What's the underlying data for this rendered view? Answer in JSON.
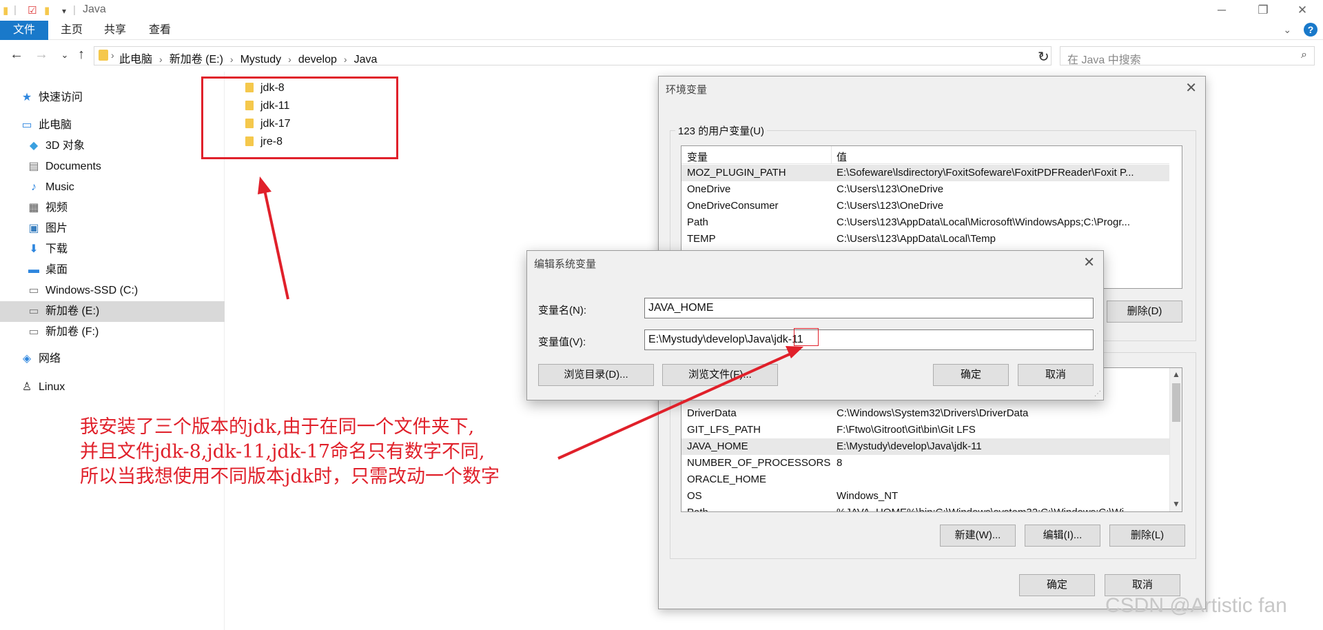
{
  "window": {
    "title": "Java",
    "minimize": "─",
    "maximize": "❐",
    "close": "✕"
  },
  "ribbon": {
    "tabs": [
      "文件",
      "主页",
      "共享",
      "查看"
    ],
    "help": "?"
  },
  "address": {
    "crumbs": [
      "此电脑",
      "新加卷 (E:)",
      "Mystudy",
      "develop",
      "Java"
    ],
    "search_placeholder": "在 Java 中搜索"
  },
  "sidebar": {
    "items": [
      {
        "label": "快速访问",
        "icon": "star-icon"
      },
      {
        "label": "此电脑",
        "icon": "computer-icon"
      },
      {
        "label": "3D 对象",
        "icon": "cube-icon"
      },
      {
        "label": "Documents",
        "icon": "document-icon"
      },
      {
        "label": "Music",
        "icon": "music-icon"
      },
      {
        "label": "视频",
        "icon": "video-icon"
      },
      {
        "label": "图片",
        "icon": "picture-icon"
      },
      {
        "label": "下载",
        "icon": "download-icon"
      },
      {
        "label": "桌面",
        "icon": "desktop-icon"
      },
      {
        "label": "Windows-SSD (C:)",
        "icon": "drive-icon"
      },
      {
        "label": "新加卷 (E:)",
        "icon": "drive-icon",
        "selected": true
      },
      {
        "label": "新加卷 (F:)",
        "icon": "drive-icon"
      },
      {
        "label": "网络",
        "icon": "network-icon"
      },
      {
        "label": "Linux",
        "icon": "linux-icon"
      }
    ]
  },
  "files": [
    "jdk-8",
    "jdk-11",
    "jdk-17",
    "jre-8"
  ],
  "annotation": {
    "lines": [
      "我安装了三个版本的jdk,由于在同一个文件夹下,",
      "并且文件jdk-8,jdk-11,jdk-17命名只有数字不同,",
      "所以当我想使用不同版本jdk时，只需改动一个数字"
    ],
    "color": "#e0202a"
  },
  "env_dialog": {
    "title": "环境变量",
    "user_group_label": "123 的用户变量(U)",
    "col_name": "变量",
    "col_value": "值",
    "user_vars": [
      {
        "name": "MOZ_PLUGIN_PATH",
        "value": "E:\\Sofeware\\lsdirectory\\FoxitSofeware\\FoxitPDFReader\\Foxit P..."
      },
      {
        "name": "OneDrive",
        "value": "C:\\Users\\123\\OneDrive"
      },
      {
        "name": "OneDriveConsumer",
        "value": "C:\\Users\\123\\OneDrive"
      },
      {
        "name": "Path",
        "value": "C:\\Users\\123\\AppData\\Local\\Microsoft\\WindowsApps;C:\\Progr..."
      },
      {
        "name": "TEMP",
        "value": "C:\\Users\\123\\AppData\\Local\\Temp"
      }
    ],
    "user_delete": "删除(D)",
    "sys_vars": [
      {
        "name": "DriverData",
        "value": "C:\\Windows\\System32\\Drivers\\DriverData"
      },
      {
        "name": "GIT_LFS_PATH",
        "value": "F:\\Ftwo\\Gitroot\\Git\\bin\\Git LFS"
      },
      {
        "name": "JAVA_HOME",
        "value": "E:\\Mystudy\\develop\\Java\\jdk-11"
      },
      {
        "name": "NUMBER_OF_PROCESSORS",
        "value": "8"
      },
      {
        "name": "ORACLE_HOME",
        "value": ""
      },
      {
        "name": "OS",
        "value": "Windows_NT"
      },
      {
        "name": "Path",
        "value": "%JAVA_HOME%\\bin;C:\\Windows\\system32;C:\\Windows;C:\\Wi..."
      }
    ],
    "sys_new": "新建(W)...",
    "sys_edit": "编辑(I)...",
    "sys_delete": "删除(L)",
    "ok": "确定",
    "cancel": "取消"
  },
  "edit_dialog": {
    "title": "编辑系统变量",
    "name_label": "变量名(N):",
    "name_value": "JAVA_HOME",
    "value_label": "变量值(V):",
    "value_value": "E:\\Mystudy\\develop\\Java\\jdk-11",
    "browse_dir": "浏览目录(D)...",
    "browse_file": "浏览文件(F)...",
    "ok": "确定",
    "cancel": "取消"
  },
  "watermark": "CSDN @Artistic fan"
}
